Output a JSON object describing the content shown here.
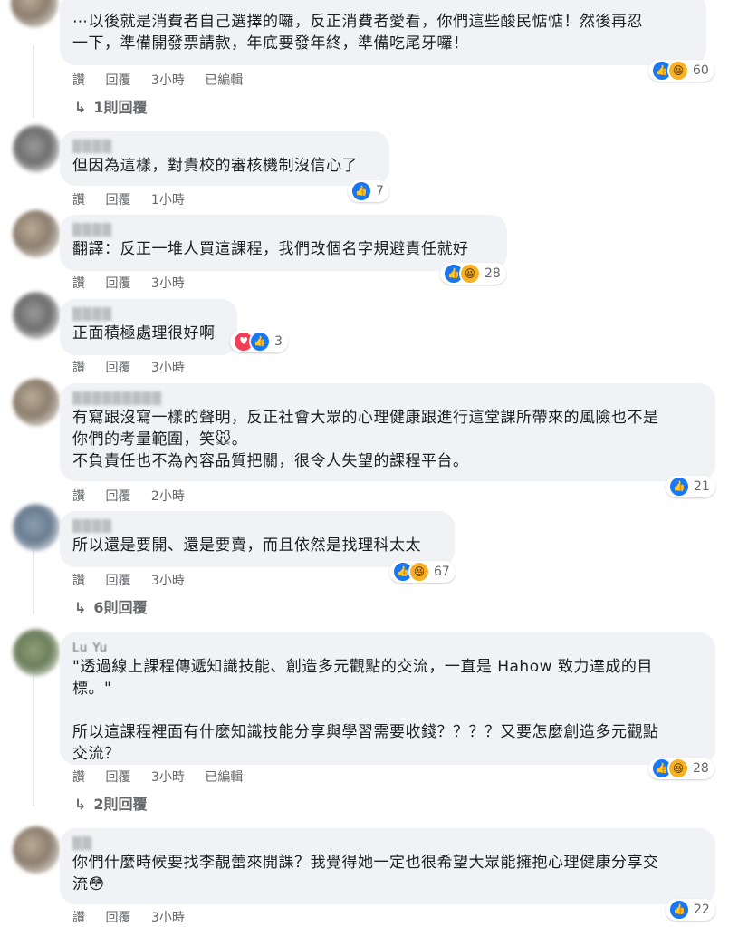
{
  "actions": {
    "like": "讚",
    "reply": "回覆",
    "edited": "已編輯"
  },
  "comments": [
    {
      "name": "",
      "text": "⋯以後就是消費者自己選擇的囉，反正消費者愛看，你們這些酸民惦惦！然後再忍\n一下，準備開發票請款，年底要發年終，準備吃尾牙囉！",
      "time": "3小時",
      "edited": true,
      "reactions": {
        "types": [
          "like",
          "haha"
        ],
        "count": "60"
      },
      "replies": "1則回覆"
    },
    {
      "name": "",
      "text": "但因為這樣，對貴校的審核機制沒信心了",
      "time": "1小時",
      "reactions": {
        "types": [
          "like"
        ],
        "count": "7"
      }
    },
    {
      "name": "",
      "text": "翻譯：反正一堆人買這課程，我們改個名字規避責任就好",
      "time": "3小時",
      "reactions": {
        "types": [
          "like",
          "haha"
        ],
        "count": "28"
      }
    },
    {
      "name": "",
      "text": "正面積極處理很好啊",
      "time": "3小時",
      "reactions": {
        "types": [
          "love",
          "like"
        ],
        "count": "3"
      }
    },
    {
      "name": "",
      "text": "有寫跟沒寫一樣的聲明，反正社會大眾的心理健康跟進行這堂課所帶來的風險也不是\n你們的考量範圍，笑🐭。\n不負責任也不為內容品質把關，很令人失望的課程平台。",
      "time": "2小時",
      "reactions": {
        "types": [
          "like"
        ],
        "count": "21"
      }
    },
    {
      "name": "",
      "text": "所以還是要開、還是要賣，而且依然是找理科太太",
      "time": "3小時",
      "reactions": {
        "types": [
          "like",
          "haha"
        ],
        "count": "67"
      },
      "replies": "6則回覆"
    },
    {
      "name": "Lu Yu",
      "text": "\"透過線上課程傳遞知識技能、創造多元觀點的交流，一直是 Hahow 致力達成的目\n標。\"\n\n所以這課程裡面有什麼知識技能分享與學習需要收錢？？？？又要怎麼創造多元觀點\n交流？",
      "time": "3小時",
      "edited": true,
      "reactions": {
        "types": [
          "like",
          "haha"
        ],
        "count": "28"
      },
      "replies": "2則回覆"
    },
    {
      "name": "",
      "text": "你們什麼時候要找李靚蕾來開課？我覺得她一定也很希望大眾能擁抱心理健康分享交\n流😳",
      "time": "3小時",
      "reactions": {
        "types": [
          "like"
        ],
        "count": "22"
      }
    }
  ]
}
